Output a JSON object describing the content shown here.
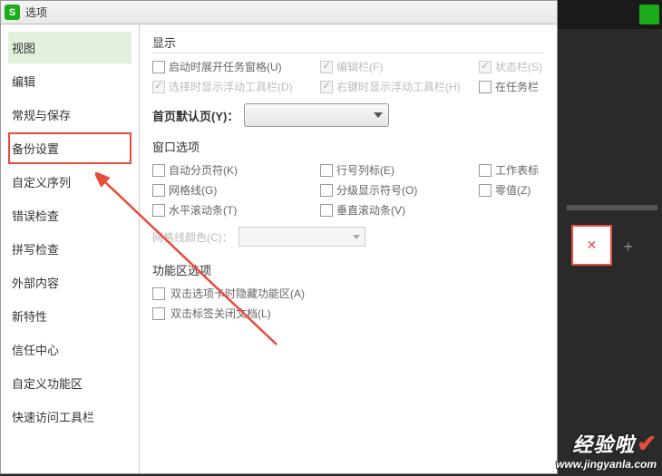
{
  "title": "选项",
  "sidebar": {
    "items": [
      "视图",
      "编辑",
      "常规与保存",
      "备份设置",
      "自定义序列",
      "错误检查",
      "拼写检查",
      "外部内容",
      "新特性",
      "信任中心",
      "自定义功能区",
      "快速访问工具栏"
    ]
  },
  "display": {
    "section": "显示",
    "startup_taskpane": "启动时展开任务窗格(U)",
    "edit_bar": "编辑栏(F)",
    "status_bar": "状态栏(S)",
    "select_float_toolbar": "选择时显示浮动工具栏(D)",
    "right_float_toolbar": "右键时显示浮动工具栏(H)",
    "in_taskbar": "在任务栏",
    "default_tab_label": "首页默认页(Y)："
  },
  "window_opts": {
    "section": "窗口选项",
    "auto_pagebreak": "自动分页符(K)",
    "row_col_label": "行号列标(E)",
    "sheet_label": "工作表标",
    "gridlines": "网格线(G)",
    "level_indicator": "分级显示符号(O)",
    "zero_value": "零值(Z)",
    "h_scroll": "水平滚动条(T)",
    "v_scroll": "垂直滚动条(V)",
    "grid_color_label": "网格线颜色(C)："
  },
  "ribbon_opts": {
    "section": "功能区选项",
    "dbl_tab_hide": "双击选项卡时隐藏功能区(A)",
    "dbl_tab_close": "双击标签关闭文档(L)"
  },
  "watermark": {
    "brand": "经验啦",
    "url": "www.jingyanla.com"
  }
}
